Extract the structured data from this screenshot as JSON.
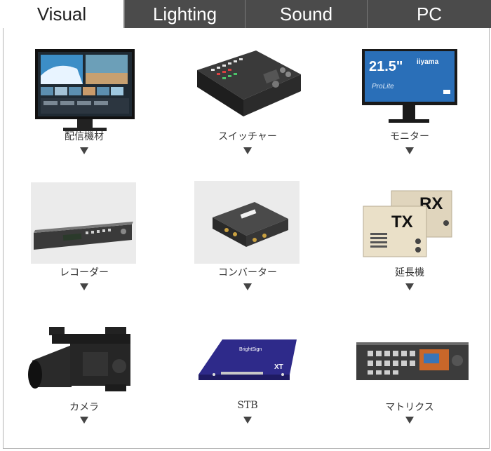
{
  "tabs": [
    {
      "label": "Visual",
      "active": true
    },
    {
      "label": "Lighting",
      "active": false
    },
    {
      "label": "Sound",
      "active": false
    },
    {
      "label": "PC",
      "active": false
    }
  ],
  "items": [
    {
      "label": "配信機材",
      "icon": "streaming-monitor-image"
    },
    {
      "label": "スイッチャー",
      "icon": "video-switcher-image"
    },
    {
      "label": "モニター",
      "icon": "monitor-image",
      "monitor_size": "21.5\"",
      "monitor_brand": "iiyama",
      "monitor_series": "ProLite"
    },
    {
      "label": "レコーダー",
      "icon": "recorder-image"
    },
    {
      "label": "コンバーター",
      "icon": "converter-image"
    },
    {
      "label": "延長機",
      "icon": "extender-image",
      "rx": "RX",
      "tx": "TX"
    },
    {
      "label": "カメラ",
      "icon": "camera-image"
    },
    {
      "label": "STB",
      "icon": "stb-image",
      "stb_brand": "BrightSign",
      "stb_model": "XT"
    },
    {
      "label": "マトリクス",
      "icon": "matrix-router-image"
    }
  ],
  "colors": {
    "tab_active_bg": "#ffffff",
    "tab_inactive_bg": "#4b4b4b",
    "tab_inactive_text": "#ffffff",
    "arrow": "#444444",
    "stb_blue": "#2e2a8a"
  }
}
